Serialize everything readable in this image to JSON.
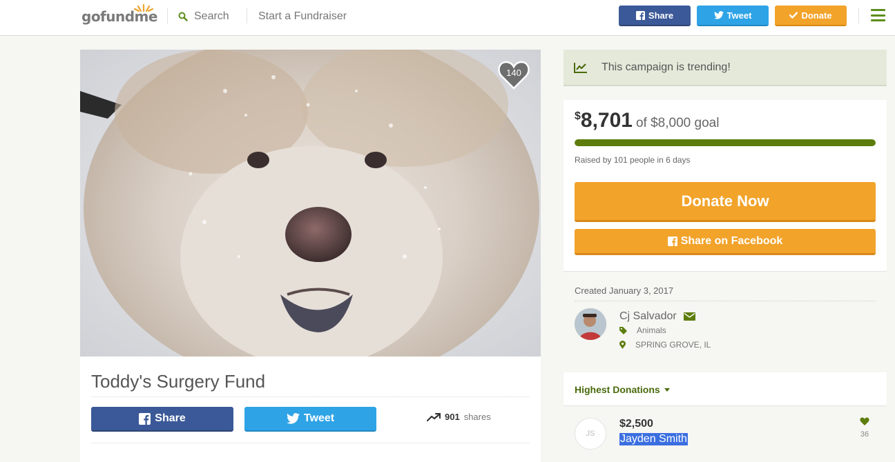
{
  "header": {
    "logo": "gofundme",
    "search_label": "Search",
    "start_label": "Start a Fundraiser",
    "share_label": "Share",
    "tweet_label": "Tweet",
    "donate_label": "Donate"
  },
  "campaign": {
    "likes": "140",
    "title": "Toddy's Surgery Fund",
    "share_label": "Share",
    "tweet_label": "Tweet",
    "shares_count": "901",
    "shares_label": "shares"
  },
  "sidebar": {
    "trending_text": "This campaign is trending!",
    "currency": "$",
    "raised_amount": "8,701",
    "goal_text": "of $8,000 goal",
    "progress_percent": 100,
    "raised_by": "Raised by 101 people in 6 days",
    "donate_now_label": "Donate Now",
    "share_facebook_label": "Share on Facebook",
    "created": "Created January 3, 2017",
    "organizer_name": "Cj Salvador",
    "category": "Animals",
    "location": "SPRING GROVE, IL",
    "highest_donations_label": "Highest Donations",
    "top_donation": {
      "initials": "JS",
      "amount": "$2,500",
      "name": "Jayden Smith",
      "likes": "36"
    }
  },
  "colors": {
    "accent_green": "#5c7d0b",
    "orange": "#f2a32a",
    "facebook_blue": "#3b5998",
    "twitter_blue": "#2ea3e6"
  }
}
